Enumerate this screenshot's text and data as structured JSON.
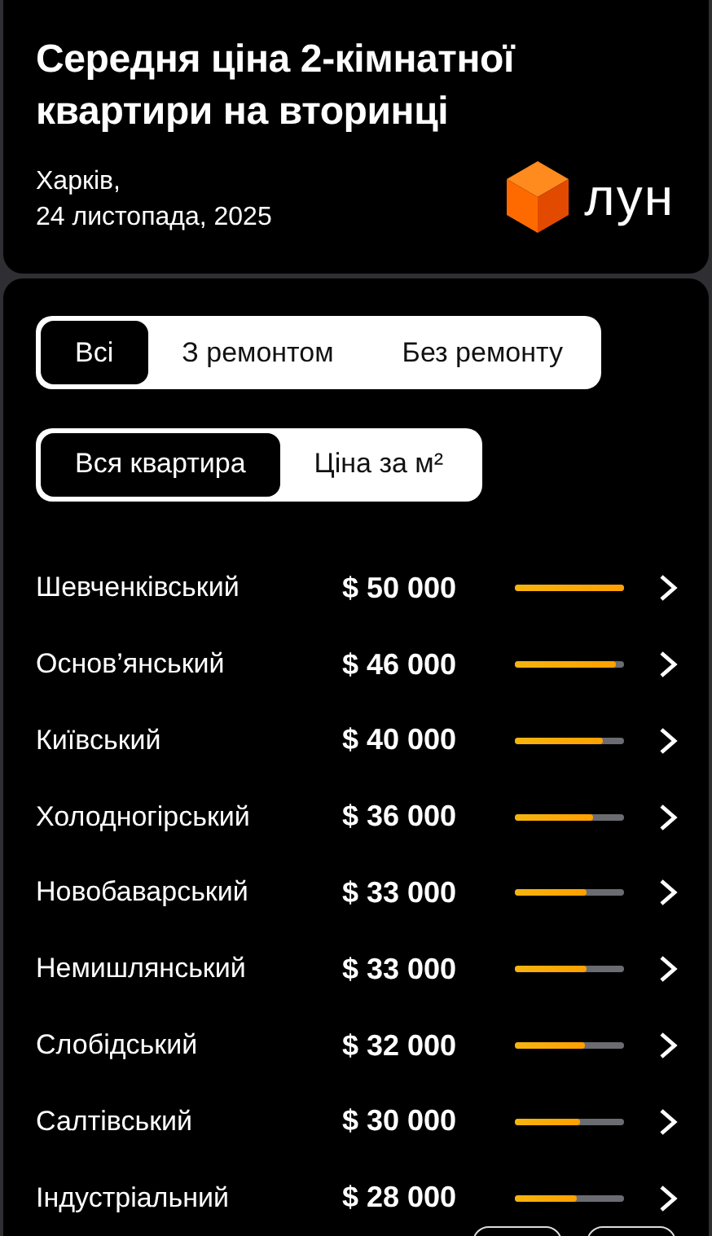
{
  "header": {
    "title": "Середня ціна 2-кімнатної квартири на вторинці",
    "city": "Харків,",
    "date": "24 листопада, 2025",
    "logo_text": "лун"
  },
  "condition_tabs": [
    {
      "label": "Всі",
      "selected": true
    },
    {
      "label": "З ремонтом",
      "selected": false
    },
    {
      "label": "Без ремонту",
      "selected": false
    }
  ],
  "price_tabs": [
    {
      "label": "Вся квартира",
      "selected": true
    },
    {
      "label": "Ціна за м²",
      "selected": false
    }
  ],
  "districts": [
    {
      "name": "Шевченківський",
      "price": "$ 50 000",
      "level": 1.0
    },
    {
      "name": "Основ’янський",
      "price": "$ 46 000",
      "level": 0.93
    },
    {
      "name": "Київський",
      "price": "$ 40 000",
      "level": 0.8
    },
    {
      "name": "Холодногірський",
      "price": "$ 36 000",
      "level": 0.72
    },
    {
      "name": "Новобаварський",
      "price": "$ 33 000",
      "level": 0.66
    },
    {
      "name": "Немишлянський",
      "price": "$ 33 000",
      "level": 0.66
    },
    {
      "name": "Слобідський",
      "price": "$ 32 000",
      "level": 0.64
    },
    {
      "name": "Салтівський",
      "price": "$ 30 000",
      "level": 0.6
    },
    {
      "name": "Індустріальний",
      "price": "$ 28 000",
      "level": 0.57
    }
  ]
}
